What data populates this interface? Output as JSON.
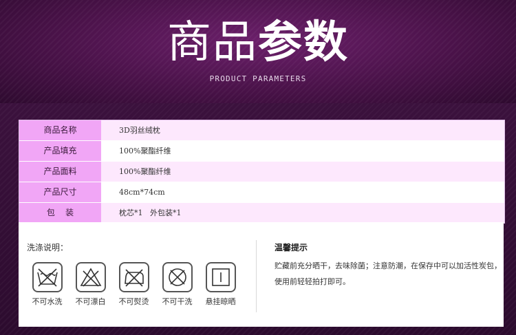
{
  "header": {
    "title_light": "商品",
    "title_bold": "参数",
    "subtitle": "PRODUCT PARAMETERS"
  },
  "params": [
    {
      "label": "商品名称",
      "value": "3D羽丝绒枕"
    },
    {
      "label": "产品填充",
      "value": "100%聚酯纤维"
    },
    {
      "label": "产品面料",
      "value": "100%聚酯纤维"
    },
    {
      "label": "产品尺寸",
      "value": "48cm*74cm"
    },
    {
      "label": "包    装",
      "value": "枕芯*1   外包装*1"
    }
  ],
  "care": {
    "title": "洗涤说明：",
    "icons": [
      {
        "icon": "no-wash-icon",
        "label": "不可水洗"
      },
      {
        "icon": "no-bleach-icon",
        "label": "不可漂白"
      },
      {
        "icon": "no-iron-icon",
        "label": "不可熨烫"
      },
      {
        "icon": "no-dry-clean-icon",
        "label": "不可干洗"
      },
      {
        "icon": "hang-dry-icon",
        "label": "悬挂晾晒"
      }
    ]
  },
  "tips": {
    "title": "温馨提示",
    "text": "贮藏前充分晒干，去味除菌；注意防潮，在保存中可以加活性炭包，使用前轻轻拍打即可。"
  },
  "colors": {
    "header_bg": "#4a1249",
    "label_bg": "#f1a6f6",
    "row_alt_bg": "#fde8fd",
    "card_bg": "#ffffff"
  }
}
